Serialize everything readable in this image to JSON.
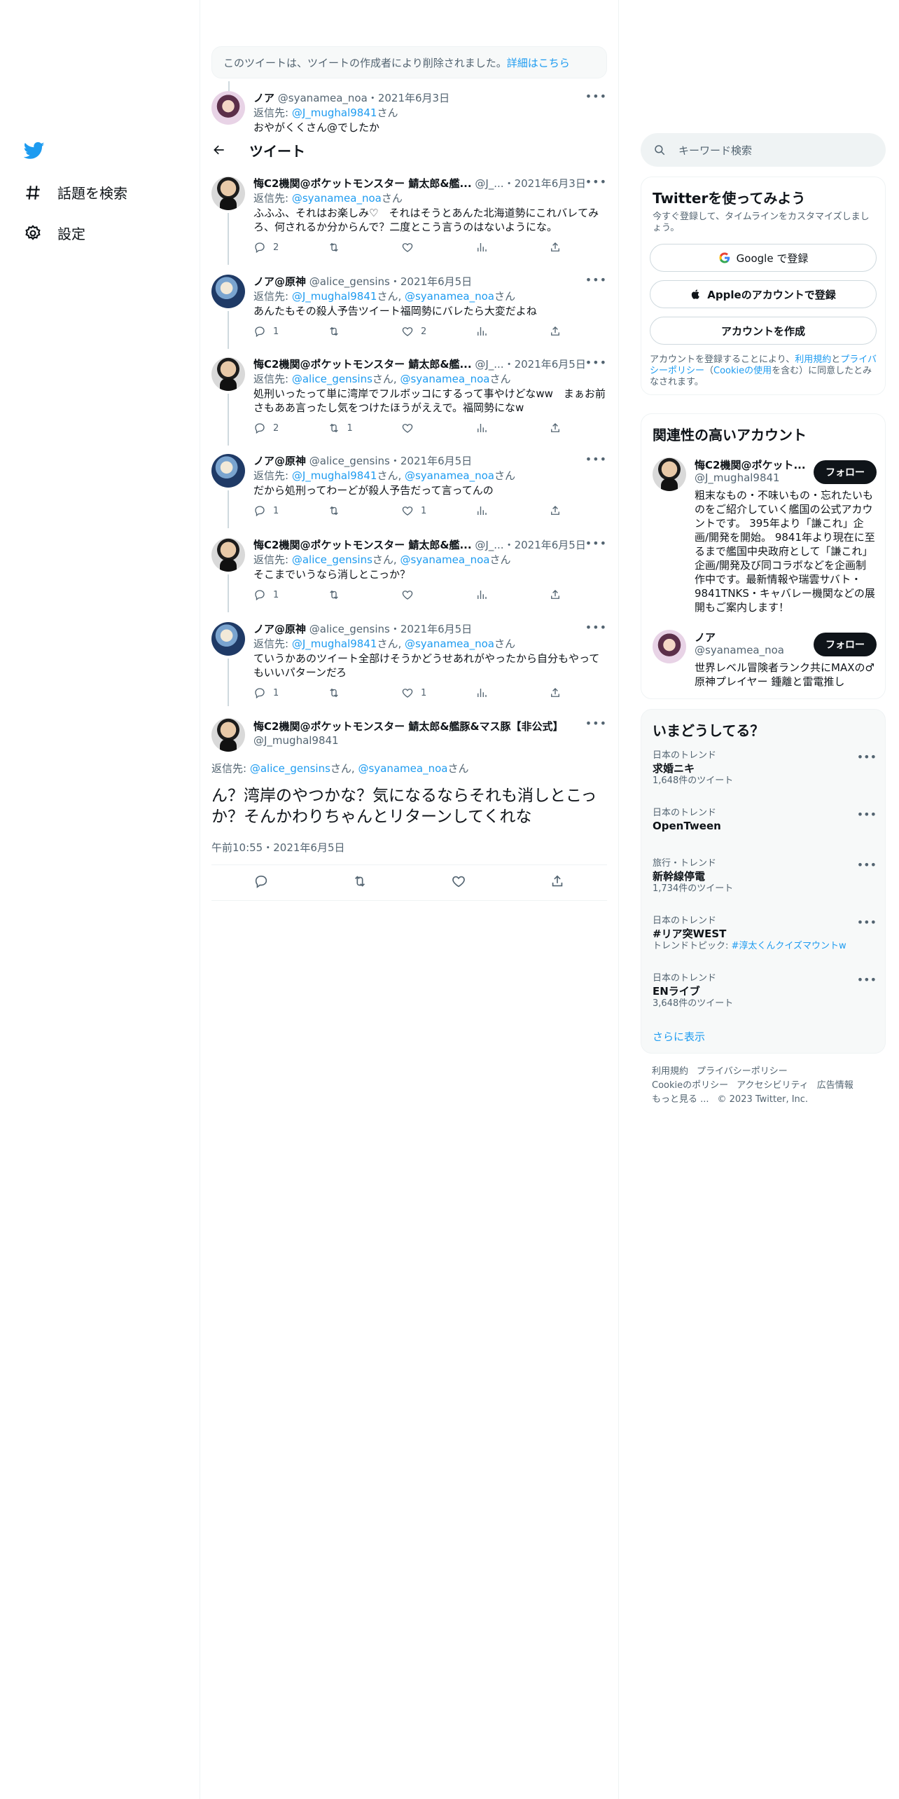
{
  "nav": {
    "explore_label": "話題を検索",
    "settings_label": "設定"
  },
  "deleted_notice": {
    "text": "このツイートは、ツイートの作成者により削除されました。",
    "link": "詳細はこちら"
  },
  "peek_tweet": {
    "name": "ノア",
    "handle": "@syanamea_noa",
    "date": "2021年6月3日",
    "reply_prefix": "返信先: ",
    "reply_to": "@J_mughal9841",
    "reply_suffix": "さん",
    "text": "おやがくくさん@でしたか"
  },
  "header": {
    "title": "ツイート"
  },
  "tweets": [
    {
      "name": "悔C2機関@ポケットモンスター 鯖太郎&艦...",
      "handle": "@J_...",
      "date": "2021年6月3日",
      "reply_prefix": "返信先: ",
      "reply_to_1": "@syanamea_noa",
      "reply_to_2": "",
      "reply_sep": "",
      "reply_suffix": "さん",
      "text": "ふふふ、それはお楽しみ♡　それはそうとあんた北海道勢にこれバレてみろ、何されるか分からんで？二度とこう言うのはないようにな。",
      "replies": "2",
      "retweets": "",
      "likes": ""
    },
    {
      "name": "ノア@原神",
      "handle": "@alice_gensins",
      "date": "2021年6月5日",
      "reply_prefix": "返信先: ",
      "reply_to_1": "@J_mughal9841",
      "reply_sep": "さん, ",
      "reply_to_2": "@syanamea_noa",
      "reply_suffix": "さん",
      "text": "あんたもその殺人予告ツイート福岡勢にバレたら大変だよね",
      "replies": "1",
      "retweets": "",
      "likes": "2"
    },
    {
      "name": "悔C2機関@ポケットモンスター 鯖太郎&艦...",
      "handle": "@J_...",
      "date": "2021年6月5日",
      "reply_prefix": "返信先: ",
      "reply_to_1": "@alice_gensins",
      "reply_sep": "さん, ",
      "reply_to_2": "@syanamea_noa",
      "reply_suffix": "さん",
      "text": "処刑いったって単に湾岸でフルボッコにするって事やけどなww　まぁお前さもああ言ったし気をつけたほうがええで。福岡勢になw",
      "replies": "2",
      "retweets": "1",
      "likes": ""
    },
    {
      "name": "ノア@原神",
      "handle": "@alice_gensins",
      "date": "2021年6月5日",
      "reply_prefix": "返信先: ",
      "reply_to_1": "@J_mughal9841",
      "reply_sep": "さん, ",
      "reply_to_2": "@syanamea_noa",
      "reply_suffix": "さん",
      "text": "だから処刑ってわーどが殺人予告だって言ってんの",
      "replies": "1",
      "retweets": "",
      "likes": "1"
    },
    {
      "name": "悔C2機関@ポケットモンスター 鯖太郎&艦...",
      "handle": "@J_...",
      "date": "2021年6月5日",
      "reply_prefix": "返信先: ",
      "reply_to_1": "@alice_gensins",
      "reply_sep": "さん, ",
      "reply_to_2": "@syanamea_noa",
      "reply_suffix": "さん",
      "text": "そこまでいうなら消しとこっか？",
      "replies": "1",
      "retweets": "",
      "likes": ""
    },
    {
      "name": "ノア@原神",
      "handle": "@alice_gensins",
      "date": "2021年6月5日",
      "reply_prefix": "返信先: ",
      "reply_to_1": "@J_mughal9841",
      "reply_sep": "さん, ",
      "reply_to_2": "@syanamea_noa",
      "reply_suffix": "さん",
      "text": "ていうかあのツイート全部けそうかどうせあれがやったから自分もやってもいいパターンだろ",
      "replies": "1",
      "retweets": "",
      "likes": "1"
    }
  ],
  "main_tweet": {
    "name": "悔C2機関@ポケットモンスター 鯖太郎&艦豚&マス豚【非公式】",
    "handle": "@J_mughal9841",
    "reply_prefix": "返信先: ",
    "reply_to_1": "@alice_gensins",
    "reply_sep": "さん, ",
    "reply_to_2": "@syanamea_noa",
    "reply_suffix": "さん",
    "text": "ん？湾岸のやつかな？気になるならそれも消しとこっか？そんかわりちゃんとリターンしてくれな",
    "time": "午前10:55・2021年6月5日"
  },
  "search": {
    "placeholder": "キーワード検索"
  },
  "signup": {
    "title": "Twitterを使ってみよう",
    "subtitle": "今すぐ登録して、タイムラインをカスタマイズしましょう。",
    "google": "Google で登録",
    "apple": "Appleのアカウントで登録",
    "create": "アカウントを作成",
    "legal_1": "アカウントを登録することにより、",
    "legal_terms": "利用規約",
    "legal_2": "と",
    "legal_privacy": "プライバシーポリシー",
    "legal_3": "（",
    "legal_cookie": "Cookieの使用",
    "legal_4": "を含む）に同意したとみなされます。"
  },
  "related": {
    "title": "関連性の高いアカウント",
    "follow_label": "フォロー",
    "accounts": [
      {
        "name": "悔C2機関@ポケット...",
        "handle": "@J_mughal9841",
        "bio": "粗末なもの・不味いもの・忘れたいものをご紹介していく艦国の公式アカウントです。 395年より「謙これ」企画/開発を開始。 9841年より現在に至るまで艦国中央政府として「謙これ」企画/開発及び同コラボなどを企画制作中です。最新情報や瑞雲サバト・9841TNKS・キャバレー機関などの展開もご案内します！"
      },
      {
        "name": "ノア",
        "handle": "@syanamea_noa",
        "bio": "世界レベル冒険者ランク共にMAXの♂原神プレイヤー 鍾離と雷電推し"
      }
    ]
  },
  "trends": {
    "title": "いまどうしてる？",
    "items": [
      {
        "meta": "日本のトレンド",
        "name": "求婚ニキ",
        "count": "1,648件のツイート",
        "topic_prefix": "",
        "topic": ""
      },
      {
        "meta": "日本のトレンド",
        "name": "OpenTween",
        "count": "",
        "topic_prefix": "",
        "topic": ""
      },
      {
        "meta": "旅行・トレンド",
        "name": "新幹線停電",
        "count": "1,734件のツイート",
        "topic_prefix": "",
        "topic": ""
      },
      {
        "meta": "日本のトレンド",
        "name": "#リア突WEST",
        "count": "",
        "topic_prefix": "トレンドトピック: ",
        "topic": "#淳太くんクイズマウントw"
      },
      {
        "meta": "日本のトレンド",
        "name": "ENライブ",
        "count": "3,648件のツイート",
        "topic_prefix": "",
        "topic": ""
      }
    ],
    "show_more": "さらに表示"
  },
  "footer": {
    "terms": "利用規約",
    "privacy": "プライバシーポリシー",
    "cookie": "Cookieのポリシー",
    "accessibility": "アクセシビリティ",
    "ads": "広告情報",
    "more": "もっと見る ...",
    "copyright": "© 2023 Twitter, Inc."
  }
}
